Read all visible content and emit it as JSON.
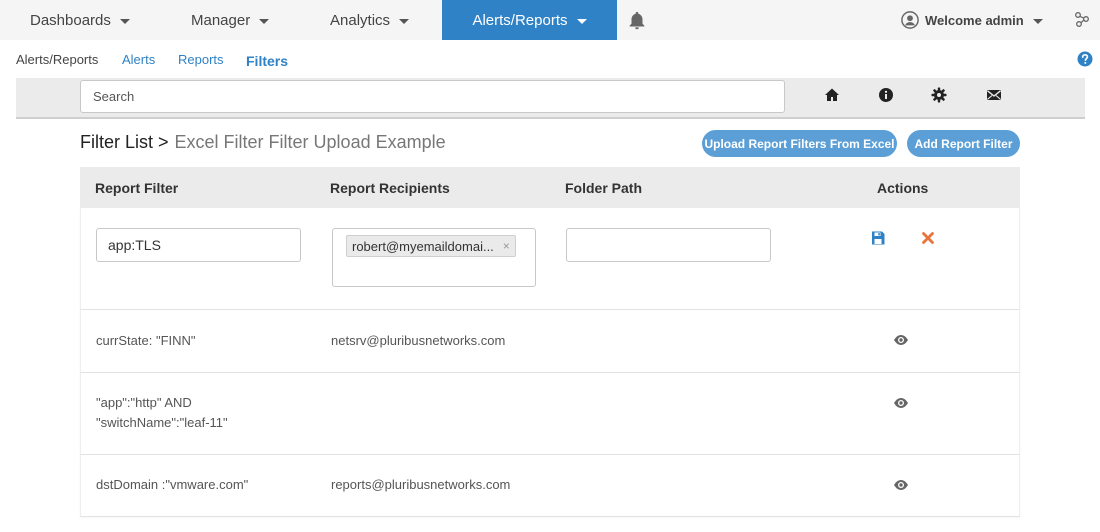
{
  "nav": {
    "dashboards": "Dashboards",
    "manager": "Manager",
    "analytics": "Analytics",
    "alerts_reports": "Alerts/Reports",
    "user": "Welcome admin"
  },
  "subnav": {
    "crumb": "Alerts/Reports",
    "alerts": "Alerts",
    "reports": "Reports",
    "filters": "Filters"
  },
  "search": {
    "placeholder": "Search"
  },
  "title": {
    "main": "Filter List >",
    "sub": "Excel Filter Filter Upload Example"
  },
  "buttons": {
    "upload": "Upload Report Filters From Excel",
    "add": "Add Report Filter"
  },
  "table": {
    "headers": [
      "Report Filter",
      "Report Recipients",
      "Folder Path",
      "Actions"
    ],
    "edit_row": {
      "filter_value": "app:TLS",
      "recipient_tag": "robert@myemaildomai...",
      "remove_tag": "×",
      "folder_value": ""
    },
    "rows": [
      {
        "filter": "currState: \"FINN\"",
        "recipient": "netsrv@pluribusnetworks.com"
      },
      {
        "filter_line1": "\"app\":\"http\" AND",
        "filter_line2": "\"switchName\":\"leaf-11\"",
        "recipient": ""
      },
      {
        "filter": "dstDomain :\"vmware.com\"",
        "recipient": "reports@pluribusnetworks.com"
      }
    ]
  },
  "colors": {
    "accent": "#2f82c6",
    "button": "#5b9fd6",
    "save_icon": "#2f82c6",
    "cancel_icon": "#e8743b"
  }
}
